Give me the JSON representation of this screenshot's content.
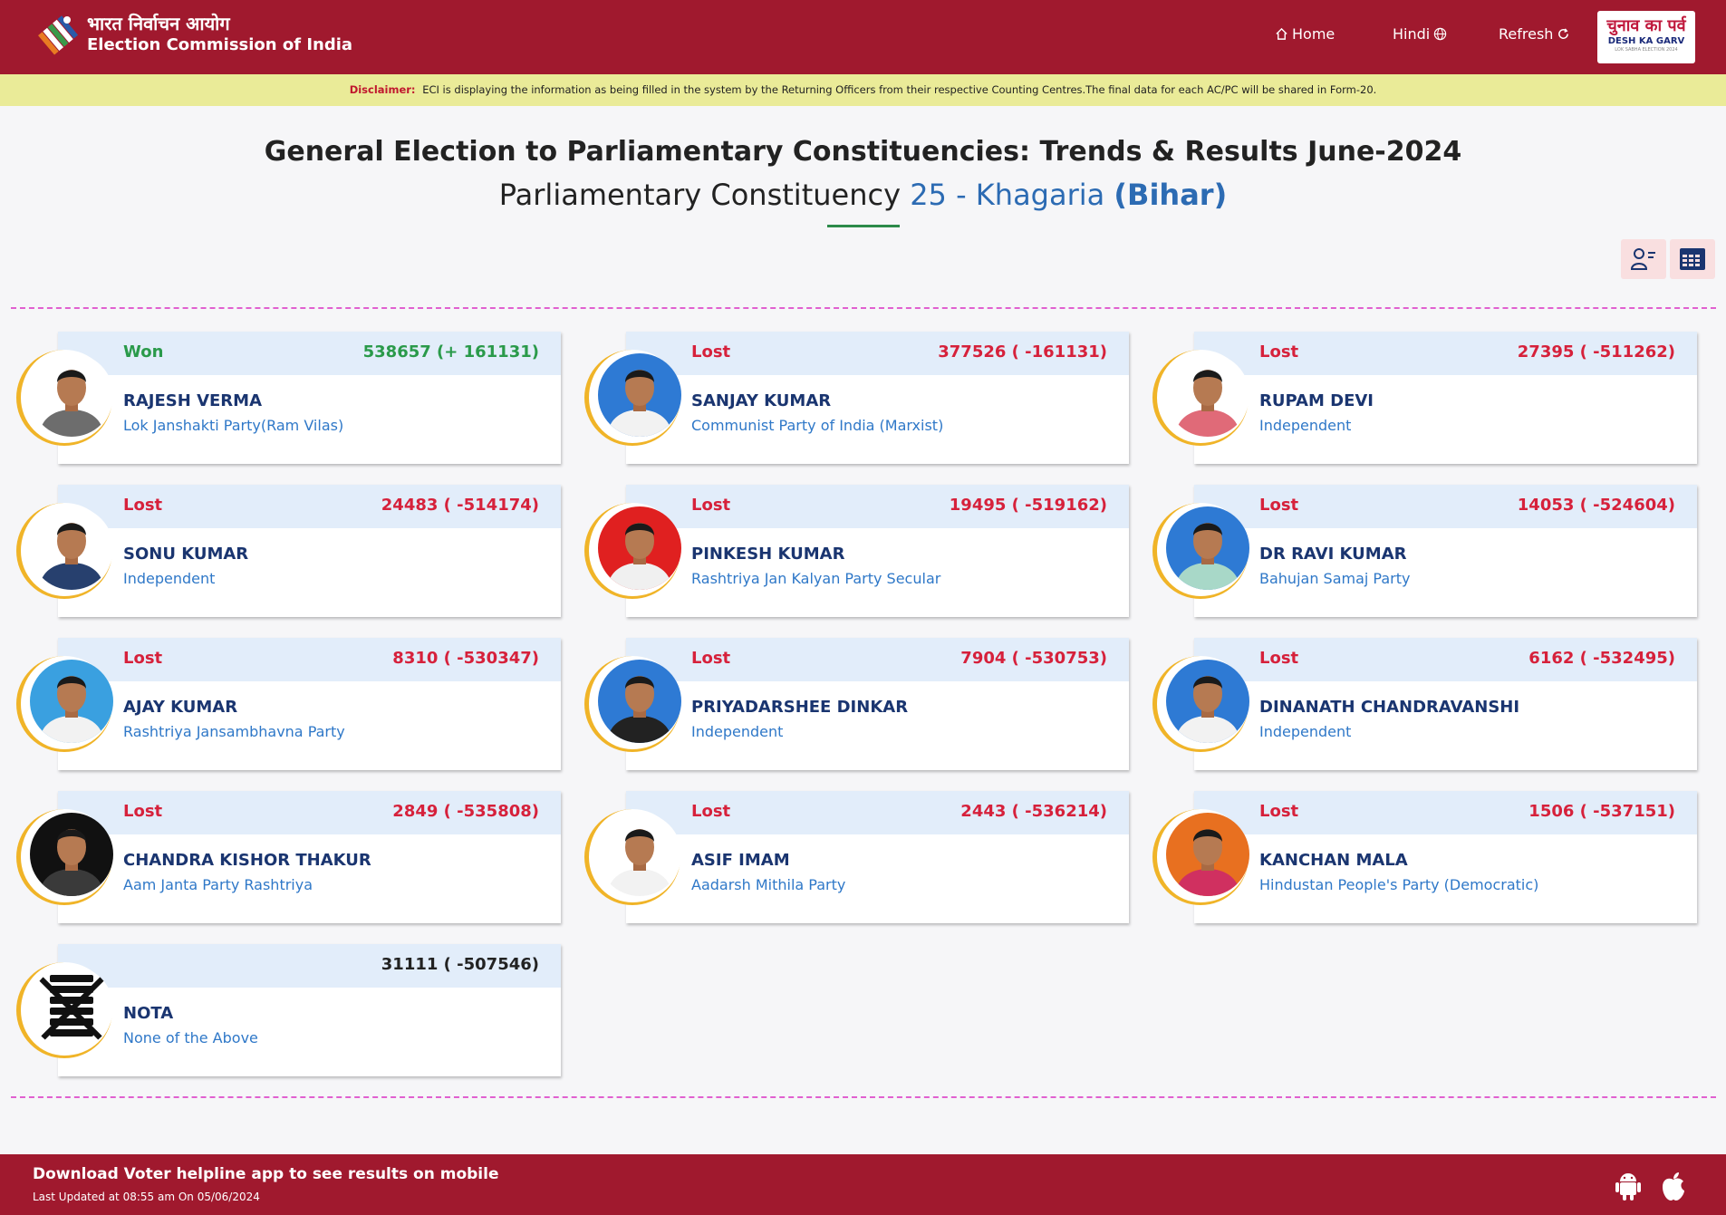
{
  "header": {
    "brand_hindi": "भारत निर्वाचन आयोग",
    "brand_english": "Election Commission of India",
    "nav": {
      "home": "Home",
      "hindi": "Hindi",
      "refresh": "Refresh"
    },
    "logo": {
      "hindi": "चुनाव का पर्व",
      "english": "DESH KA GARV",
      "sub": "LOK SABHA ELECTION 2024"
    }
  },
  "disclaimer": {
    "label": "Disclaimer:",
    "text": "ECI is displaying the information as being filled in the system by the Returning Officers from their respective Counting Centres.The final data for each AC/PC will be shared in Form-20."
  },
  "title": {
    "line1": "General Election to Parliamentary Constituencies: Trends & Results June-2024",
    "line2_prefix": "Parliamentary Constituency",
    "pc_name": "25 - Khagaria",
    "state": "(Bihar)"
  },
  "candidates": [
    {
      "status": "Won",
      "votes": "538657 (+ 161131)",
      "name": "RAJESH VERMA",
      "party": "Lok Janshakti Party(Ram Vilas)",
      "photo_bg": "#ffffff",
      "shirt": "#6d6d6d"
    },
    {
      "status": "Lost",
      "votes": "377526 ( -161131)",
      "name": "SANJAY KUMAR",
      "party": "Communist Party of India (Marxist)",
      "photo_bg": "#2e7ad4",
      "shirt": "#f2f2f2"
    },
    {
      "status": "Lost",
      "votes": "27395 ( -511262)",
      "name": "RUPAM DEVI",
      "party": "Independent",
      "photo_bg": "#ffffff",
      "shirt": "#e06a78"
    },
    {
      "status": "Lost",
      "votes": "24483 ( -514174)",
      "name": "SONU KUMAR",
      "party": "Independent",
      "photo_bg": "#ffffff",
      "shirt": "#27406e"
    },
    {
      "status": "Lost",
      "votes": "19495 ( -519162)",
      "name": "PINKESH KUMAR",
      "party": "Rashtriya Jan Kalyan Party Secular",
      "photo_bg": "#e02020",
      "shirt": "#f0f0f0"
    },
    {
      "status": "Lost",
      "votes": "14053 ( -524604)",
      "name": "DR RAVI KUMAR",
      "party": "Bahujan Samaj Party",
      "photo_bg": "#2e7ad4",
      "shirt": "#a8d8c8"
    },
    {
      "status": "Lost",
      "votes": "8310 ( -530347)",
      "name": "AJAY KUMAR",
      "party": "Rashtriya Jansambhavna Party",
      "photo_bg": "#3aa0e0",
      "shirt": "#f2f2f2"
    },
    {
      "status": "Lost",
      "votes": "7904 ( -530753)",
      "name": "PRIYADARSHEE DINKAR",
      "party": "Independent",
      "photo_bg": "#2e7ad4",
      "shirt": "#222222"
    },
    {
      "status": "Lost",
      "votes": "6162 ( -532495)",
      "name": "DINANATH CHANDRAVANSHI",
      "party": "Independent",
      "photo_bg": "#2e7ad4",
      "shirt": "#f2f2f2"
    },
    {
      "status": "Lost",
      "votes": "2849 ( -535808)",
      "name": "CHANDRA KISHOR THAKUR",
      "party": "Aam Janta Party Rashtriya",
      "photo_bg": "#111111",
      "shirt": "#3a3a3a"
    },
    {
      "status": "Lost",
      "votes": "2443 ( -536214)",
      "name": "ASIF IMAM",
      "party": "Aadarsh Mithila Party",
      "photo_bg": "#ffffff",
      "shirt": "#f2f2f2"
    },
    {
      "status": "Lost",
      "votes": "1506 ( -537151)",
      "name": "KANCHAN MALA",
      "party": "Hindustan People's Party (Democratic)",
      "photo_bg": "#e87020",
      "shirt": "#d03060"
    }
  ],
  "nota": {
    "status": "",
    "votes": "31111 ( -507546)",
    "name": "NOTA",
    "party": "None of the Above"
  },
  "footer": {
    "title": "Download Voter helpline app to see results on mobile",
    "updated": "Last Updated at 08:55 am On 05/06/2024"
  },
  "colors": {
    "primary": "#a0192e",
    "won": "#2a9a4a",
    "lost": "#d6213b",
    "party": "#2f78c8",
    "name": "#1a3570"
  }
}
